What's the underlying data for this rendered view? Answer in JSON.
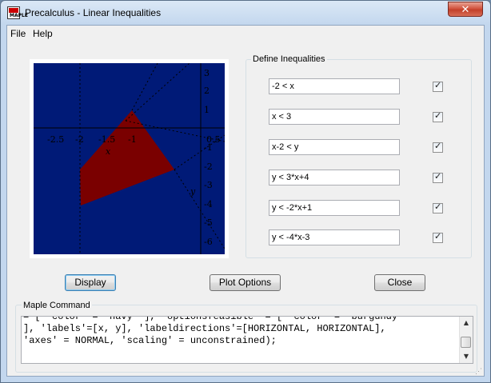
{
  "window": {
    "title": "Precalculus - Linear Inequalities",
    "close_glyph": "✕"
  },
  "menu": {
    "items": [
      "File",
      "Help"
    ]
  },
  "app_icon": {
    "text": "MAPLE"
  },
  "plot": {
    "x_ticks": [
      "-2.5",
      "-2",
      "-1.5",
      "-1",
      "0.5"
    ],
    "y_ticks": [
      "3",
      "2",
      "1",
      "-1",
      "-2",
      "-3",
      "-4",
      "-5",
      "-6"
    ],
    "x_label": "x",
    "y_label": "y",
    "colors": {
      "background": "navy",
      "feasible": "burgundy"
    }
  },
  "inequalities": {
    "group_label": "Define Inequalities",
    "items": [
      {
        "expression": "-2 < x",
        "enabled": true
      },
      {
        "expression": "x < 3",
        "enabled": true
      },
      {
        "expression": "x-2 < y",
        "enabled": true
      },
      {
        "expression": "y < 3*x+4",
        "enabled": true
      },
      {
        "expression": "y < -2*x+1",
        "enabled": true
      },
      {
        "expression": "y < -4*x-3",
        "enabled": true
      }
    ]
  },
  "buttons": {
    "display": "Display",
    "plot_options": "Plot Options",
    "close": "Close"
  },
  "command": {
    "label": "Maple Command",
    "lines": [
      "= [ 'color' = \"navy\" ], 'optionsfeasible' = [ 'color' = \"burgundy\"",
      "], 'labels'=[x, y], 'labeldirections'=[HORIZONTAL, HORIZONTAL],",
      "'axes' = NORMAL, 'scaling' = unconstrained);"
    ]
  }
}
